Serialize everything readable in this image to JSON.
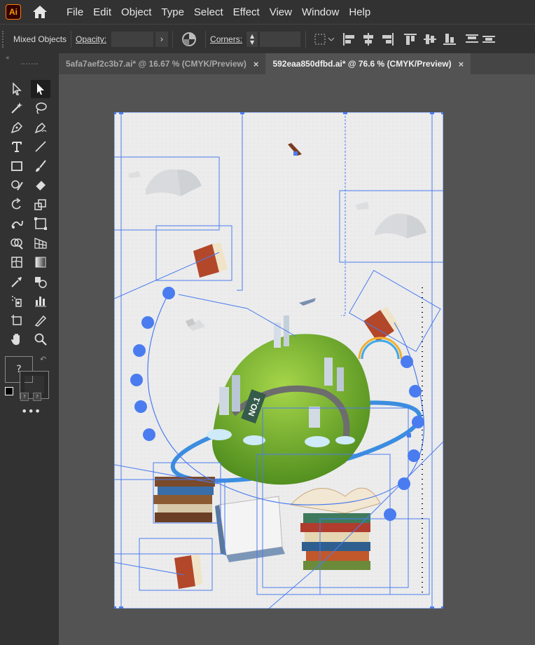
{
  "app": {
    "logo": "Ai"
  },
  "menu": [
    "File",
    "Edit",
    "Object",
    "Type",
    "Select",
    "Effect",
    "View",
    "Window",
    "Help"
  ],
  "control_bar": {
    "selection_label": "Mixed Objects",
    "opacity_label": "Opacity:",
    "opacity_value": "",
    "corners_label": "Corners:",
    "corners_value": ""
  },
  "tabs": [
    {
      "label": "5afa7aef2c3b7.ai* @ 16.67 % (CMYK/Preview)",
      "close": "×",
      "active": false
    },
    {
      "label": "592eaa850dfbd.ai* @ 76.6 % (CMYK/Preview)",
      "close": "×",
      "active": true
    }
  ],
  "tools": [
    "direct-selection-tool",
    "selection-tool",
    "magic-wand-tool",
    "lasso-tool",
    "pen-tool",
    "curvature-tool",
    "type-tool",
    "line-tool",
    "rectangle-tool",
    "paintbrush-tool",
    "shaper-tool",
    "eraser-tool",
    "rotate-tool",
    "scale-tool",
    "puppet-warp-tool",
    "free-transform-tool",
    "shape-builder-tool",
    "perspective-grid-tool",
    "mesh-tool",
    "gradient-tool",
    "eyedropper-tool",
    "blend-tool",
    "symbol-sprayer-tool",
    "column-graph-tool",
    "artboard-tool",
    "slice-tool",
    "hand-tool",
    "zoom-tool"
  ],
  "fill_stroke": {
    "unknown_fill_glyph": "?",
    "swatch_glyph": "?"
  },
  "artwork": {
    "badge_text": "NO.1"
  },
  "colors": {
    "ui_dark": "#323232",
    "canvas_bg": "#535353",
    "tab_strip": "#454545",
    "selection_blue": "#4a7cf0",
    "logo_orange": "#ff9a00",
    "globe_green": "#6faa2e"
  }
}
